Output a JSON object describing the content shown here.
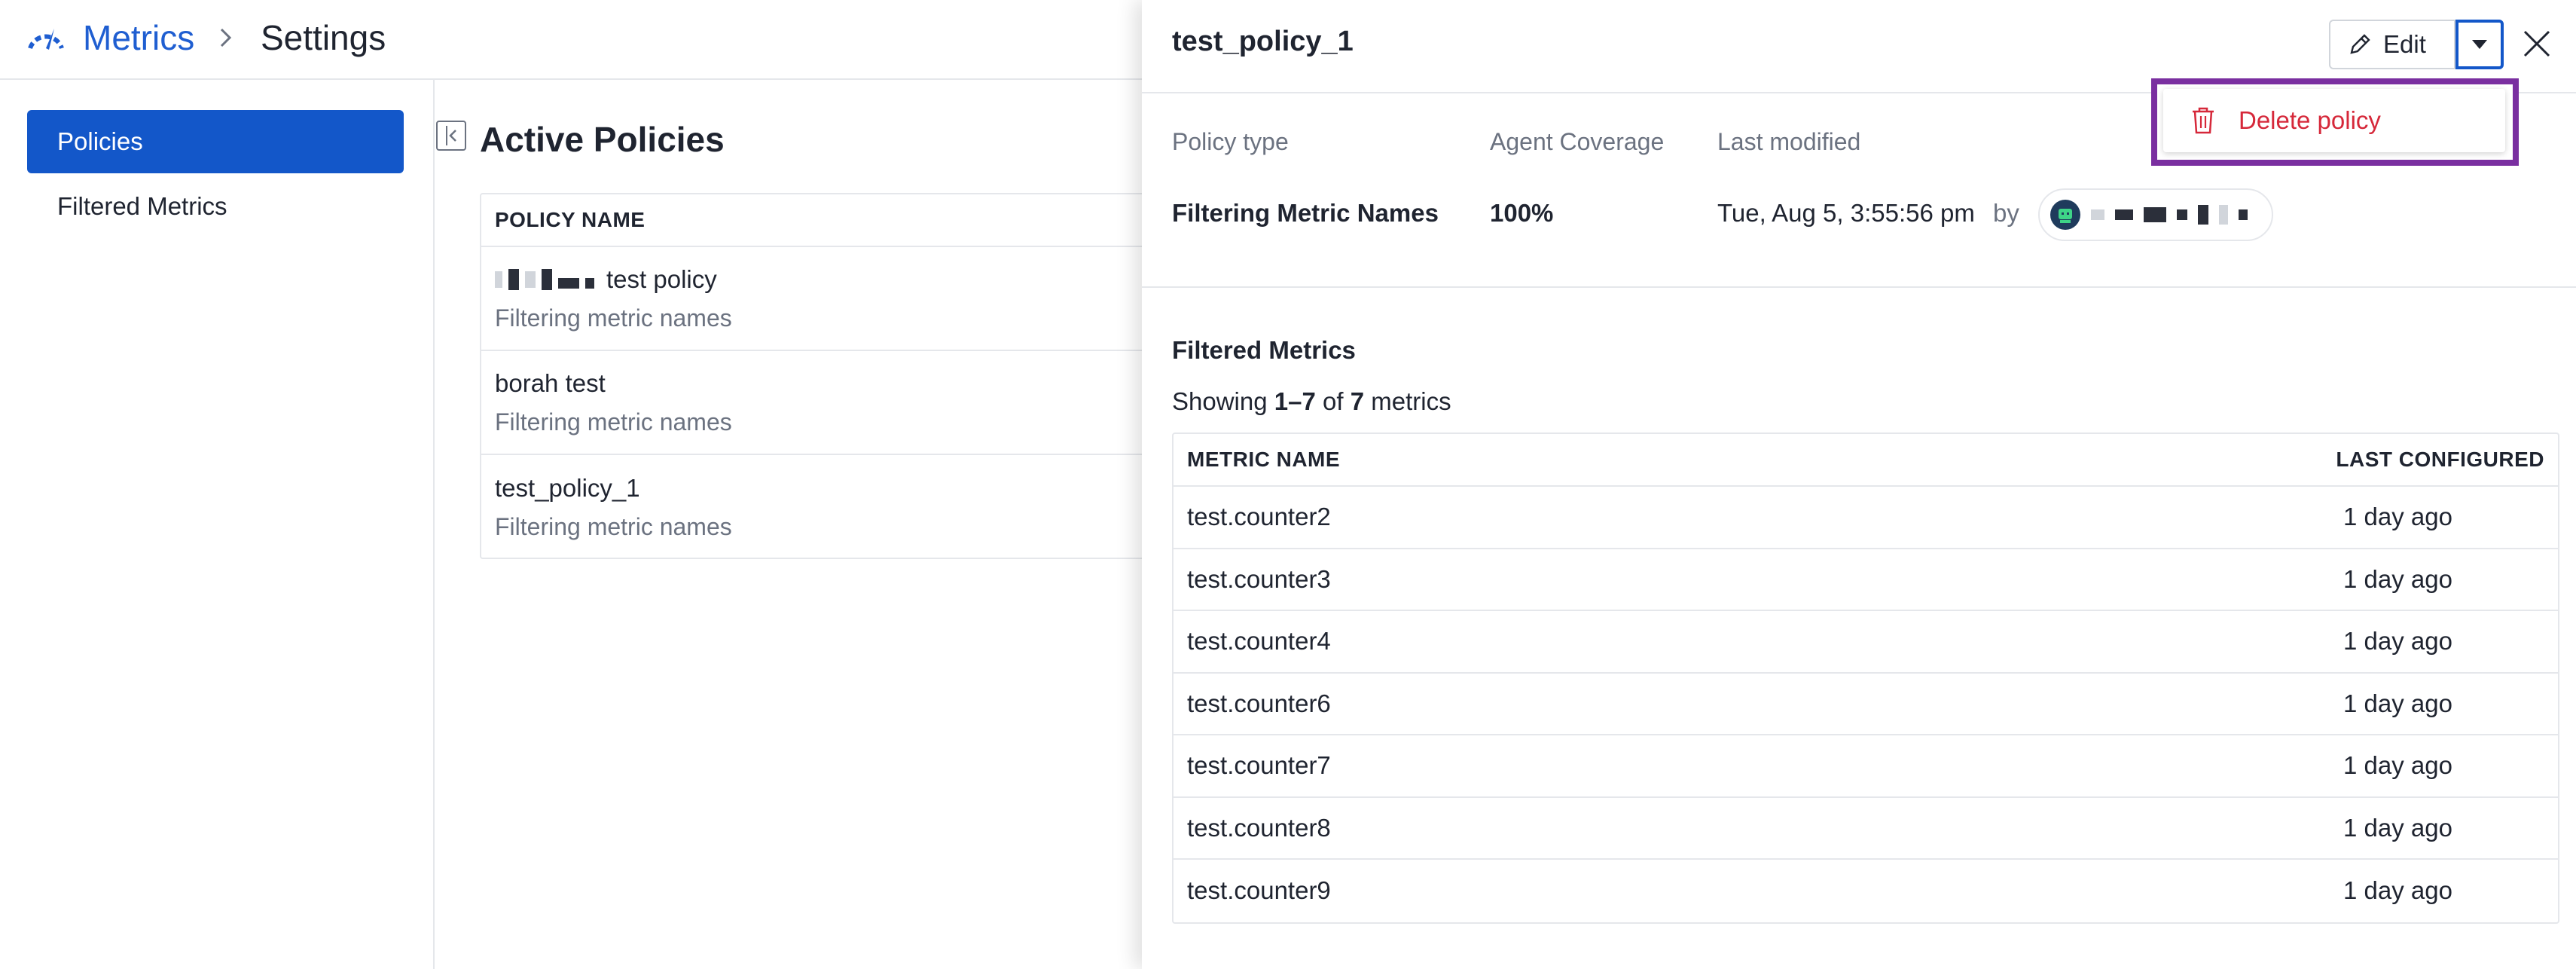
{
  "breadcrumb": {
    "app": "Metrics",
    "separator": ">",
    "page": "Settings"
  },
  "sidebar": {
    "items": [
      {
        "label": "Policies",
        "active": true
      },
      {
        "label": "Filtered Metrics",
        "active": false
      }
    ]
  },
  "main": {
    "title": "Active Policies",
    "table": {
      "header": "POLICY NAME",
      "rows": [
        {
          "name": "test policy",
          "type": "Filtering metric names"
        },
        {
          "name": "borah test",
          "type": "Filtering metric names"
        },
        {
          "name": "test_policy_1",
          "type": "Filtering metric names"
        }
      ]
    }
  },
  "drawer": {
    "title": "test_policy_1",
    "edit_label": "Edit",
    "menu": {
      "delete_label": "Delete policy"
    },
    "labels": {
      "policy_type": "Policy type",
      "agent_coverage": "Agent Coverage",
      "last_modified": "Last modified"
    },
    "values": {
      "policy_type": "Filtering Metric Names",
      "agent_coverage": "100%",
      "last_modified": "Tue, Aug 5, 3:55:56 pm",
      "by": "by"
    },
    "filtered": {
      "title": "Filtered Metrics",
      "showing_prefix": "Showing",
      "range": "1–7",
      "of": "of",
      "total": "7",
      "suffix": "metrics",
      "columns": {
        "name": "METRIC NAME",
        "configured": "LAST CONFIGURED"
      },
      "rows": [
        {
          "name": "test.counter2",
          "configured": "1 day ago"
        },
        {
          "name": "test.counter3",
          "configured": "1 day ago"
        },
        {
          "name": "test.counter4",
          "configured": "1 day ago"
        },
        {
          "name": "test.counter6",
          "configured": "1 day ago"
        },
        {
          "name": "test.counter7",
          "configured": "1 day ago"
        },
        {
          "name": "test.counter8",
          "configured": "1 day ago"
        },
        {
          "name": "test.counter9",
          "configured": "1 day ago"
        }
      ]
    }
  },
  "colors": {
    "accent": "#1357c9",
    "danger": "#d6283a",
    "highlight": "#7a2fa0"
  }
}
